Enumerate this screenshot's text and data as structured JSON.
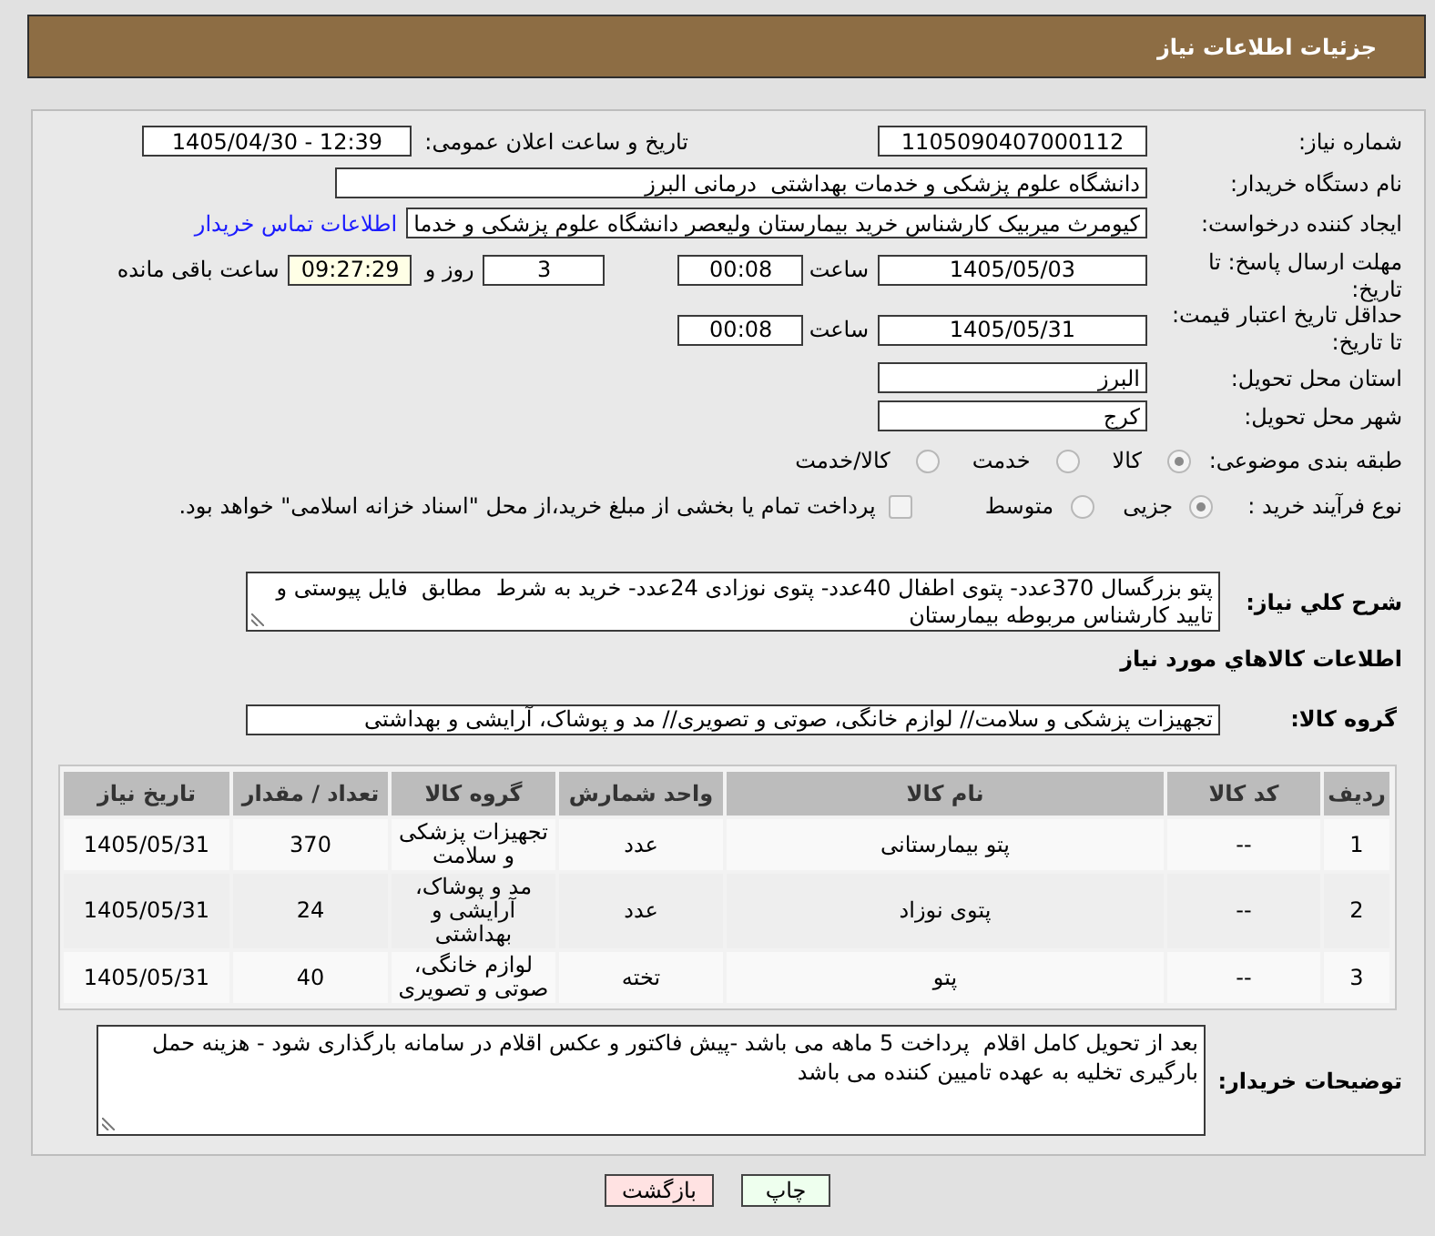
{
  "header": {
    "title": "جزئیات اطلاعات نیاز"
  },
  "details": {
    "need_number": {
      "label": "شماره نیاز:",
      "value": "1105090407000112"
    },
    "announce_datetime": {
      "label": "تاریخ و ساعت اعلان عمومی:",
      "value": "1405/04/30 - 12:39"
    },
    "buyer_org": {
      "label": "نام دستگاه خریدار:",
      "value": "دانشگاه علوم پزشکی و خدمات بهداشتی  درمانی البرز"
    },
    "requester": {
      "label": "ایجاد کننده درخواست:",
      "value": "کیومرث میربیک کارشناس خرید بیمارستان ولیعصر دانشگاه علوم پزشکی و خدما",
      "link": "اطلاعات تماس خریدار"
    },
    "reply_deadline": {
      "label": "مهلت ارسال پاسخ: تا تاریخ:",
      "date": "1405/05/03",
      "time_label": "ساعت",
      "time": "00:08",
      "days": "3",
      "days_label": "روز و",
      "remaining": "09:27:29",
      "remaining_label": "ساعت باقی مانده"
    },
    "price_validity": {
      "label": "حداقل تاریخ اعتبار قیمت: تا تاریخ:",
      "date": "1405/05/31",
      "time_label": "ساعت",
      "time": "00:08"
    },
    "delivery_province": {
      "label": "استان محل تحویل:",
      "value": "البرز"
    },
    "delivery_city": {
      "label": "شهر محل تحویل:",
      "value": "کرج"
    },
    "subject_category": {
      "label": "طبقه بندی موضوعی:",
      "options": [
        {
          "label": "کالا",
          "selected": true
        },
        {
          "label": "خدمت",
          "selected": false
        },
        {
          "label": "کالا/خدمت",
          "selected": false
        }
      ]
    },
    "purchase_process": {
      "label": "نوع فرآیند خرید :",
      "options": [
        {
          "label": "جزیی",
          "selected": true
        },
        {
          "label": "متوسط",
          "selected": false
        }
      ],
      "treasury_payment": {
        "label": "پرداخت تمام یا بخشی از مبلغ خرید،از محل \"اسناد خزانه اسلامی\" خواهد بود.",
        "checked": false
      }
    },
    "general_description": {
      "label": "شرح کلي نياز:",
      "value": "پتو بزرگسال 370عدد- پتوی اطفال 40عدد- پتوی نوزادی 24عدد- خرید به شرط  مطابق  فایل پیوستی و تایید کارشناس مربوطه بیمارستان"
    }
  },
  "goods": {
    "title": "اطلاعات کالاهاي مورد نياز",
    "group": {
      "label": "گروه کالا:",
      "value": "تجهیزات پزشکی و سلامت// لوازم خانگی، صوتی و تصویری// مد و پوشاک، آرایشی و بهداشتی"
    },
    "table": {
      "columns": [
        "ردیف",
        "کد کالا",
        "نام کالا",
        "واحد شمارش",
        "گروه کالا",
        "تعداد / مقدار",
        "تاریخ نیاز"
      ],
      "rows": [
        [
          "1",
          "--",
          "پتو بیمارستانی",
          "عدد",
          "تجهیزات پزشکی و سلامت",
          "370",
          "1405/05/31"
        ],
        [
          "2",
          "--",
          "پتوی نوزاد",
          "عدد",
          "مد و پوشاک، آرایشی و بهداشتی",
          "24",
          "1405/05/31"
        ],
        [
          "3",
          "--",
          "پتو",
          "تخته",
          "لوازم خانگی، صوتی و تصویری",
          "40",
          "1405/05/31"
        ]
      ]
    }
  },
  "buyer_notes": {
    "label": "توضیحات خریدار:",
    "value": "بعد از تحویل کامل اقلام  پرداخت 5 ماهه می باشد -پیش فاکتور و عکس اقلام در سامانه بارگذاری شود - هزینه حمل بارگیری تخلیه به عهده تامیین کننده می باشد"
  },
  "buttons": [
    {
      "label": "چاپ",
      "kind": "print"
    },
    {
      "label": "بازگشت",
      "kind": "back"
    }
  ]
}
